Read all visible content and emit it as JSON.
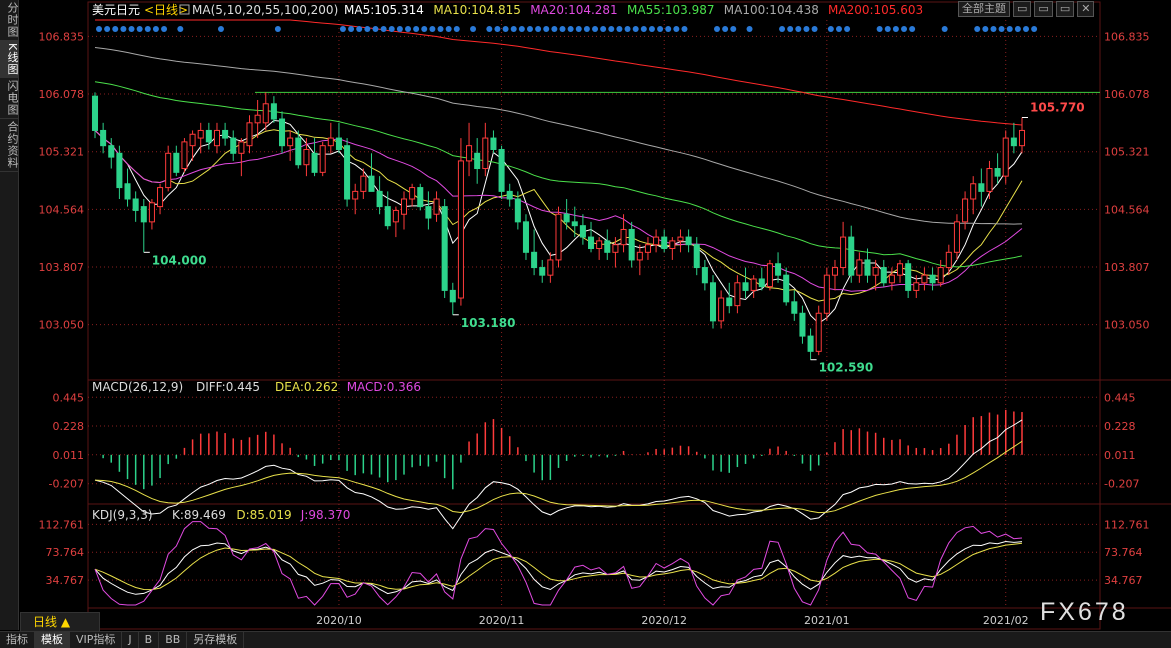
{
  "sidebar": {
    "items": [
      {
        "label": "分时图"
      },
      {
        "label": "K线图"
      },
      {
        "label": "闪电图"
      },
      {
        "label": "合约资料"
      }
    ]
  },
  "toolbar": {
    "theme_label": "全部主题",
    "buttons": [
      "▭",
      "▭",
      "▭",
      "✕"
    ]
  },
  "bottom_tabs": [
    "指标",
    "模板",
    "VIP指标",
    "J",
    "B",
    "BB",
    "另存模板"
  ],
  "period_button": "日线",
  "watermark": "FX678",
  "colors": {
    "up": "#ff3b3b",
    "down": "#2cd38b",
    "ma5": "#ffffff",
    "ma10": "#e8e04a",
    "ma20": "#e04ae0",
    "ma55": "#4be04b",
    "ma100": "#a8a8a8",
    "ma200": "#ff2a2a",
    "grid": "#8a1f1f",
    "dots": "#2a7ad8"
  },
  "chart_data": [
    {
      "type": "candlestick",
      "title_symbol": "美元日元",
      "title_period": "<日线>",
      "indicator_label": "MA(5,10,20,55,100,200)",
      "ma_labels": [
        "MA5:105.314",
        "MA10:104.815",
        "MA20:104.281",
        "MA55:103.987",
        "MA100:104.438",
        "MA200:105.603"
      ],
      "y_ticks": [
        "106.835",
        "106.078",
        "105.321",
        "104.564",
        "103.807",
        "103.050"
      ],
      "ylim": [
        102.35,
        107.05
      ],
      "x_ticks": [
        "2020/10",
        "2020/11",
        "2020/12",
        "2021/01",
        "2021/02"
      ],
      "horizontal_line": 106.1,
      "annotations": [
        {
          "text": "104.000",
          "value": 104.0,
          "index": 6
        },
        {
          "text": "103.180",
          "value": 103.18,
          "index": 44
        },
        {
          "text": "102.590",
          "value": 102.59,
          "index": 88
        },
        {
          "text": "105.770",
          "value": 105.77,
          "index": 114
        }
      ],
      "candles": [
        [
          106.05,
          106.1,
          105.5,
          105.6
        ],
        [
          105.6,
          105.7,
          105.3,
          105.4
        ],
        [
          105.4,
          105.5,
          105.1,
          105.25
        ],
        [
          105.3,
          105.4,
          104.7,
          104.85
        ],
        [
          104.9,
          105.1,
          104.6,
          104.7
        ],
        [
          104.7,
          104.8,
          104.4,
          104.55
        ],
        [
          104.6,
          104.7,
          104.0,
          104.4
        ],
        [
          104.4,
          104.7,
          104.3,
          104.65
        ],
        [
          104.6,
          104.9,
          104.5,
          104.85
        ],
        [
          104.85,
          105.4,
          104.8,
          105.3
        ],
        [
          105.3,
          105.4,
          105.0,
          105.05
        ],
        [
          105.1,
          105.5,
          105.05,
          105.45
        ],
        [
          105.4,
          105.6,
          105.2,
          105.55
        ],
        [
          105.5,
          105.7,
          105.3,
          105.6
        ],
        [
          105.6,
          105.7,
          105.35,
          105.45
        ],
        [
          105.4,
          105.7,
          105.3,
          105.6
        ],
        [
          105.6,
          105.7,
          105.4,
          105.5
        ],
        [
          105.5,
          105.6,
          105.2,
          105.3
        ],
        [
          105.3,
          105.5,
          105.0,
          105.45
        ],
        [
          105.4,
          105.8,
          105.3,
          105.7
        ],
        [
          105.7,
          106.0,
          105.5,
          105.8
        ],
        [
          105.7,
          106.1,
          105.6,
          105.95
        ],
        [
          105.95,
          106.05,
          105.7,
          105.75
        ],
        [
          105.75,
          105.85,
          105.3,
          105.4
        ],
        [
          105.4,
          105.6,
          105.2,
          105.5
        ],
        [
          105.5,
          105.6,
          105.1,
          105.15
        ],
        [
          105.15,
          105.5,
          105.0,
          105.35
        ],
        [
          105.3,
          105.5,
          105.0,
          105.05
        ],
        [
          105.05,
          105.45,
          105.0,
          105.4
        ],
        [
          105.4,
          105.7,
          105.3,
          105.5
        ],
        [
          105.5,
          105.7,
          105.3,
          105.35
        ],
        [
          105.4,
          105.5,
          104.6,
          104.7
        ],
        [
          104.7,
          104.9,
          104.5,
          104.8
        ],
        [
          104.8,
          105.1,
          104.7,
          105.0
        ],
        [
          105.0,
          105.3,
          104.9,
          104.8
        ],
        [
          104.8,
          105.0,
          104.5,
          104.6
        ],
        [
          104.6,
          104.8,
          104.3,
          104.35
        ],
        [
          104.4,
          104.6,
          104.2,
          104.55
        ],
        [
          104.5,
          104.8,
          104.3,
          104.7
        ],
        [
          104.7,
          104.9,
          104.6,
          104.85
        ],
        [
          104.85,
          104.9,
          104.55,
          104.6
        ],
        [
          104.6,
          104.8,
          104.3,
          104.45
        ],
        [
          104.5,
          104.8,
          104.4,
          104.7
        ],
        [
          104.6,
          104.7,
          103.4,
          103.5
        ],
        [
          103.5,
          103.6,
          103.18,
          103.35
        ],
        [
          103.4,
          105.5,
          103.3,
          105.2
        ],
        [
          105.2,
          105.7,
          105.0,
          105.4
        ],
        [
          105.3,
          105.5,
          104.9,
          105.1
        ],
        [
          105.1,
          105.7,
          105.0,
          105.5
        ],
        [
          105.5,
          105.6,
          105.3,
          105.35
        ],
        [
          105.35,
          105.4,
          104.7,
          104.8
        ],
        [
          104.8,
          104.9,
          104.6,
          104.7
        ],
        [
          104.7,
          104.8,
          104.3,
          104.4
        ],
        [
          104.4,
          104.5,
          103.9,
          104.0
        ],
        [
          104.0,
          104.3,
          103.7,
          103.8
        ],
        [
          103.8,
          103.9,
          103.6,
          103.7
        ],
        [
          103.7,
          104.0,
          103.6,
          103.9
        ],
        [
          103.9,
          104.6,
          103.8,
          104.5
        ],
        [
          104.5,
          104.7,
          104.3,
          104.4
        ],
        [
          104.4,
          104.6,
          104.2,
          104.35
        ],
        [
          104.35,
          104.5,
          104.1,
          104.2
        ],
        [
          104.2,
          104.4,
          104.0,
          104.05
        ],
        [
          104.05,
          104.2,
          103.9,
          104.15
        ],
        [
          104.15,
          104.3,
          103.9,
          104.0
        ],
        [
          104.0,
          104.2,
          103.8,
          104.1
        ],
        [
          104.1,
          104.5,
          104.0,
          104.3
        ],
        [
          104.3,
          104.4,
          103.8,
          103.9
        ],
        [
          103.9,
          104.1,
          103.7,
          104.0
        ],
        [
          104.0,
          104.2,
          103.9,
          104.1
        ],
        [
          104.1,
          104.3,
          104.0,
          104.2
        ],
        [
          104.2,
          104.3,
          104.0,
          104.05
        ],
        [
          104.05,
          104.2,
          103.9,
          104.15
        ],
        [
          104.15,
          104.3,
          104.0,
          104.2
        ],
        [
          104.2,
          104.3,
          104.0,
          104.1
        ],
        [
          104.1,
          104.2,
          103.7,
          103.8
        ],
        [
          103.8,
          103.9,
          103.5,
          103.6
        ],
        [
          103.6,
          103.7,
          103.0,
          103.1
        ],
        [
          103.1,
          103.5,
          103.0,
          103.4
        ],
        [
          103.4,
          103.6,
          103.2,
          103.3
        ],
        [
          103.3,
          103.7,
          103.2,
          103.6
        ],
        [
          103.6,
          103.8,
          103.4,
          103.5
        ],
        [
          103.5,
          103.7,
          103.4,
          103.65
        ],
        [
          103.65,
          103.8,
          103.5,
          103.55
        ],
        [
          103.55,
          103.9,
          103.5,
          103.85
        ],
        [
          103.85,
          104.0,
          103.6,
          103.7
        ],
        [
          103.7,
          103.8,
          103.3,
          103.35
        ],
        [
          103.35,
          103.5,
          103.1,
          103.2
        ],
        [
          103.2,
          103.3,
          102.8,
          102.9
        ],
        [
          102.9,
          103.0,
          102.59,
          102.7
        ],
        [
          102.7,
          103.3,
          102.65,
          103.2
        ],
        [
          103.2,
          103.8,
          103.1,
          103.7
        ],
        [
          103.7,
          103.9,
          103.5,
          103.8
        ],
        [
          103.8,
          104.4,
          103.7,
          104.2
        ],
        [
          104.2,
          104.35,
          103.6,
          103.7
        ],
        [
          103.7,
          104.0,
          103.6,
          103.9
        ],
        [
          103.9,
          104.05,
          103.6,
          103.7
        ],
        [
          103.7,
          103.9,
          103.5,
          103.8
        ],
        [
          103.8,
          103.9,
          103.55,
          103.6
        ],
        [
          103.6,
          103.8,
          103.5,
          103.7
        ],
        [
          103.7,
          103.9,
          103.6,
          103.85
        ],
        [
          103.85,
          103.9,
          103.4,
          103.5
        ],
        [
          103.5,
          103.7,
          103.4,
          103.6
        ],
        [
          103.6,
          103.8,
          103.5,
          103.7
        ],
        [
          103.7,
          103.8,
          103.5,
          103.6
        ],
        [
          103.6,
          103.9,
          103.55,
          103.8
        ],
        [
          103.8,
          104.1,
          103.7,
          104.0
        ],
        [
          104.0,
          104.5,
          103.9,
          104.4
        ],
        [
          104.4,
          104.8,
          104.3,
          104.7
        ],
        [
          104.7,
          105.0,
          104.5,
          104.9
        ],
        [
          104.9,
          105.1,
          104.6,
          104.8
        ],
        [
          104.8,
          105.2,
          104.7,
          105.1
        ],
        [
          105.1,
          105.3,
          104.9,
          105.0
        ],
        [
          105.0,
          105.6,
          104.9,
          105.5
        ],
        [
          105.5,
          105.7,
          105.3,
          105.4
        ],
        [
          105.4,
          105.77,
          105.3,
          105.6
        ]
      ]
    },
    {
      "type": "macd",
      "title": "MACD(26,12,9)",
      "values_text": [
        "DIFF:0.445",
        "DEA:0.262",
        "MACD:0.366"
      ],
      "y_ticks": [
        "0.445",
        "0.228",
        "0.011",
        "-0.207"
      ],
      "ylim": [
        -0.33,
        0.5
      ]
    },
    {
      "type": "kdj",
      "title": "KDJ(9,3,3)",
      "values_text": [
        "K:89.469",
        "D:85.019",
        "J:98.370"
      ],
      "y_ticks": [
        "112.761",
        "73.764",
        "34.767"
      ],
      "ylim": [
        0,
        130
      ]
    }
  ]
}
